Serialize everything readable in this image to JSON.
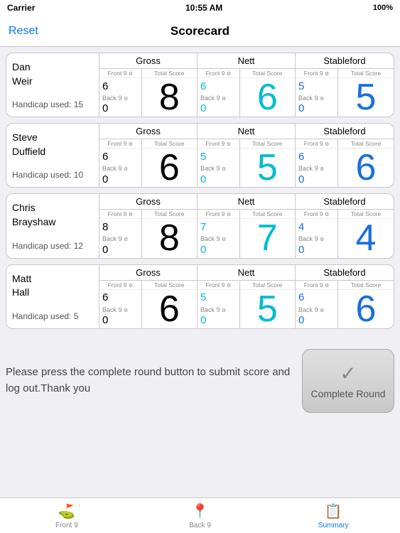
{
  "statusBar": {
    "carrier": "Carrier",
    "wifi": "WiFi",
    "time": "10:55 AM",
    "battery": "100%"
  },
  "navBar": {
    "resetLabel": "Reset",
    "title": "Scorecard"
  },
  "players": [
    {
      "firstName": "Dan",
      "lastName": "Weir",
      "handicap": "Handicap used: 15",
      "gross": {
        "label": "Gross",
        "front9Label": "Front 9",
        "back9Label": "Back 9",
        "totalScoreLabel": "Total Score",
        "front9Val": "6",
        "back9Val": "0",
        "totalVal": "8"
      },
      "nett": {
        "label": "Nett",
        "front9Label": "Front 9",
        "back9Label": "Back 9",
        "totalScoreLabel": "Total Score",
        "front9Val": "6",
        "back9Val": "0",
        "totalVal": "6"
      },
      "stableford": {
        "label": "Stableford",
        "front9Label": "Front 9",
        "back9Label": "Back 9",
        "totalScoreLabel": "Total Score",
        "front9Val": "5",
        "back9Val": "0",
        "totalVal": "5"
      }
    },
    {
      "firstName": "Steve",
      "lastName": "Duffield",
      "handicap": "Handicap used: 10",
      "gross": {
        "label": "Gross",
        "front9Label": "Front 9",
        "back9Label": "Back 9",
        "totalScoreLabel": "Total Score",
        "front9Val": "6",
        "back9Val": "0",
        "totalVal": "6"
      },
      "nett": {
        "label": "Nett",
        "front9Label": "Front 9",
        "back9Label": "Back 9",
        "totalScoreLabel": "Total Score",
        "front9Val": "5",
        "back9Val": "0",
        "totalVal": "5"
      },
      "stableford": {
        "label": "Stableford",
        "front9Label": "Front 9",
        "back9Label": "Back 9",
        "totalScoreLabel": "Total Score",
        "front9Val": "6",
        "back9Val": "0",
        "totalVal": "6"
      }
    },
    {
      "firstName": "Chris",
      "lastName": "Brayshaw",
      "handicap": "Handicap used: 12",
      "gross": {
        "label": "Gross",
        "front9Label": "Front 9",
        "back9Label": "Back 9",
        "totalScoreLabel": "Total Score",
        "front9Val": "8",
        "back9Val": "0",
        "totalVal": "8"
      },
      "nett": {
        "label": "Nett",
        "front9Label": "Front 9",
        "back9Label": "Back 9",
        "totalScoreLabel": "Total Score",
        "front9Val": "7",
        "back9Val": "0",
        "totalVal": "7"
      },
      "stableford": {
        "label": "Stableford",
        "front9Label": "Front 9",
        "back9Label": "Back 9",
        "totalScoreLabel": "Total Score",
        "front9Val": "4",
        "back9Val": "0",
        "totalVal": "4"
      }
    },
    {
      "firstName": "Matt",
      "lastName": "Hall",
      "handicap": "Handicap used: 5",
      "gross": {
        "label": "Gross",
        "front9Label": "Front 9",
        "back9Label": "Back 9",
        "totalScoreLabel": "Total Score",
        "front9Val": "6",
        "back9Val": "0",
        "totalVal": "6"
      },
      "nett": {
        "label": "Nett",
        "front9Label": "Front 9",
        "back9Label": "Back 9",
        "totalScoreLabel": "Total Score",
        "front9Val": "5",
        "back9Val": "0",
        "totalVal": "5"
      },
      "stableford": {
        "label": "Stableford",
        "front9Label": "Front 9",
        "back9Label": "Back 9",
        "totalScoreLabel": "Total Score",
        "front9Val": "6",
        "back9Val": "0",
        "totalVal": "6"
      }
    }
  ],
  "bottomSection": {
    "infoText": "Please press the complete round button to submit score and log out.Thank you",
    "completeBtnLabel": "Complete Round",
    "checkMark": "✓"
  },
  "tabBar": {
    "tabs": [
      {
        "label": "Front 9",
        "icon": "⛳",
        "active": false
      },
      {
        "label": "Back 9",
        "icon": "📍",
        "active": false
      },
      {
        "label": "Summary",
        "icon": "📋",
        "active": true
      }
    ]
  }
}
